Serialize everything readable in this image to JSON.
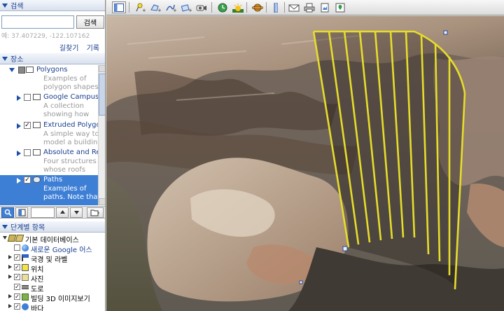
{
  "search": {
    "header": "검색",
    "button": "검색",
    "coords": "예: 37.407229, -122.107162",
    "links": [
      "길찾기",
      "기록"
    ]
  },
  "places": {
    "header": "장소",
    "items": [
      {
        "title": "Polygons",
        "desc": [
          "Examples of",
          "polygon shapes"
        ],
        "checked": false,
        "icon": "folder-icon"
      },
      {
        "title": "Google Campus",
        "desc": [
          "A collection",
          "showing how"
        ],
        "checked": false,
        "icon": "folder-icon"
      },
      {
        "title": "Extruded Polygo",
        "desc": [
          "A simple way to",
          "model a building"
        ],
        "checked": true,
        "icon": "folder-icon"
      },
      {
        "title": "Absolute and Re",
        "desc": [
          "Four structures",
          "whose roofs"
        ],
        "checked": false,
        "icon": "folder-icon"
      },
      {
        "title": "Paths",
        "desc": [
          "Examples of",
          "paths. Note that"
        ],
        "checked": true,
        "icon": "path-icon",
        "selected": true
      }
    ]
  },
  "layers": {
    "header": "단계별 항목",
    "items": [
      {
        "label": "기본 데이터베이스",
        "icon": "database-icon",
        "checked": null,
        "color": "#000000"
      },
      {
        "label": "새로운 Google 어스",
        "icon": "earth-icon",
        "checked": false,
        "color": "#1a3f8f"
      },
      {
        "label": "국경 및 라벨",
        "icon": "border-icon",
        "checked": true,
        "color": "#000000"
      },
      {
        "label": "위치",
        "icon": "location-icon",
        "checked": true,
        "color": "#000000"
      },
      {
        "label": "사진",
        "icon": "photo-icon",
        "checked": true,
        "color": "#000000"
      },
      {
        "label": "도로",
        "icon": "road-icon",
        "checked": true,
        "color": "#000000"
      },
      {
        "label": "빌딩 3D 이미지보기",
        "icon": "building-icon",
        "checked": true,
        "color": "#000000"
      },
      {
        "label": "바다",
        "icon": "ocean-icon",
        "checked": true,
        "color": "#000000"
      }
    ]
  },
  "toolbar": {
    "tools": [
      "sidebar-toggle-icon",
      "placemark-icon",
      "polygon-icon",
      "path-icon",
      "overlay-icon",
      "record-tour-icon",
      "historical-imagery-icon",
      "sun-icon",
      "planets-icon",
      "ruler-icon",
      "email-icon",
      "print-icon",
      "save-image-icon",
      "maps-icon"
    ]
  },
  "colors": {
    "path_lines": "#e6dd2a",
    "selection": "#3e7fd6",
    "link": "#1a3f8f"
  }
}
